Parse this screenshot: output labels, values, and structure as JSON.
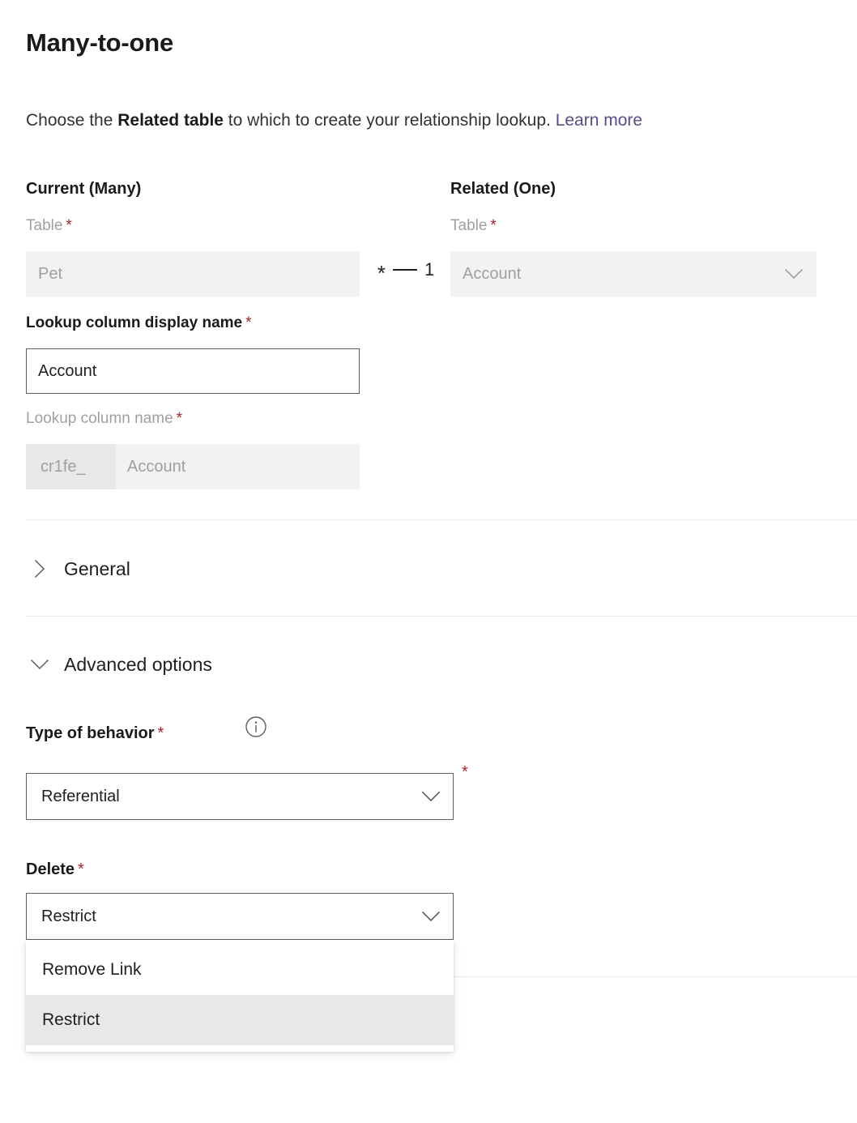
{
  "page": {
    "title": "Many-to-one",
    "description": {
      "before": "Choose the ",
      "strong": "Related table",
      "after": " to which to create your relationship lookup. ",
      "link": "Learn more"
    }
  },
  "columns": {
    "current_header": "Current (Many)",
    "related_header": "Related (One)"
  },
  "cardinality": {
    "many_symbol": "*",
    "one_symbol": "1"
  },
  "fields": {
    "current_table": {
      "label": "Table",
      "required": "*",
      "value": "Pet"
    },
    "related_table": {
      "label": "Table",
      "required": "*",
      "value": "Account"
    },
    "lookup_display_name": {
      "label": "Lookup column display name",
      "required": "*",
      "value": "Account"
    },
    "lookup_column_name": {
      "label": "Lookup column name",
      "required": "*",
      "prefix": "cr1fe_",
      "value": "Account"
    }
  },
  "sections": {
    "general": {
      "label": "General",
      "state": "collapsed"
    },
    "advanced": {
      "label": "Advanced options",
      "state": "expanded"
    }
  },
  "advanced": {
    "type_of_behavior": {
      "label": "Type of behavior",
      "required": "*",
      "value": "Referential",
      "trailing_required": "*"
    },
    "delete": {
      "label": "Delete",
      "required": "*",
      "value": "Restrict",
      "options": [
        {
          "label": "Remove Link",
          "selected": false
        },
        {
          "label": "Restrict",
          "selected": true
        }
      ]
    }
  },
  "colors": {
    "required_asterisk": "#a4262c",
    "link": "#5b4b8a",
    "disabled_field_bg": "#f3f2f1",
    "prefix_bg": "#e9e8e7",
    "border": "#605e5c",
    "divider": "#edebe9",
    "selected_option_bg": "#e9e8e7"
  }
}
